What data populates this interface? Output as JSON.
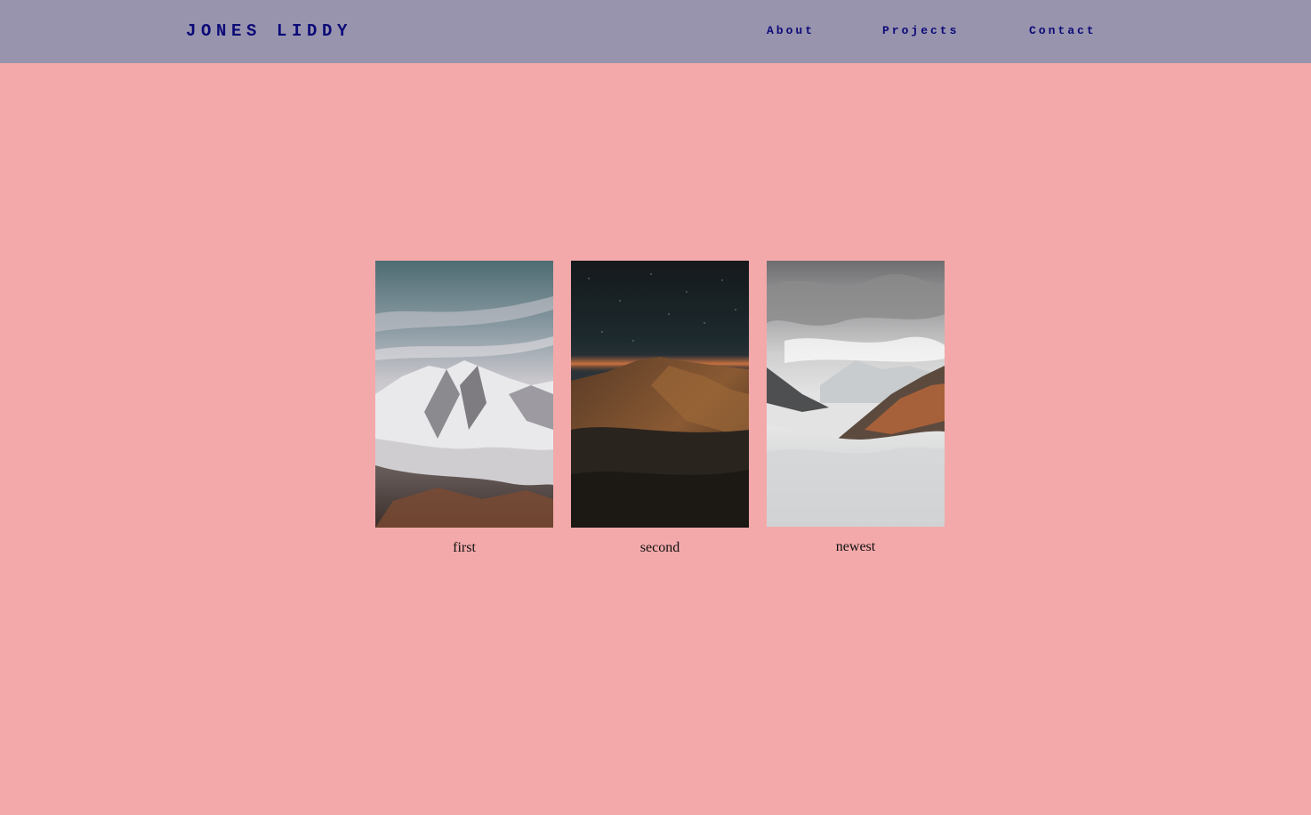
{
  "header": {
    "brand": "JONES LIDDY",
    "nav": {
      "about": "About",
      "projects": "Projects",
      "contact": "Contact"
    }
  },
  "gallery": {
    "items": [
      {
        "caption": "first",
        "image": "snowy-mountain-photo"
      },
      {
        "caption": "second",
        "image": "night-mountain-photo"
      },
      {
        "caption": "newest",
        "image": "foggy-mountain-photo"
      }
    ]
  },
  "colors": {
    "page_background": "#f3a9aa",
    "header_background": "#9894ad",
    "nav_text": "#0c0a78"
  }
}
